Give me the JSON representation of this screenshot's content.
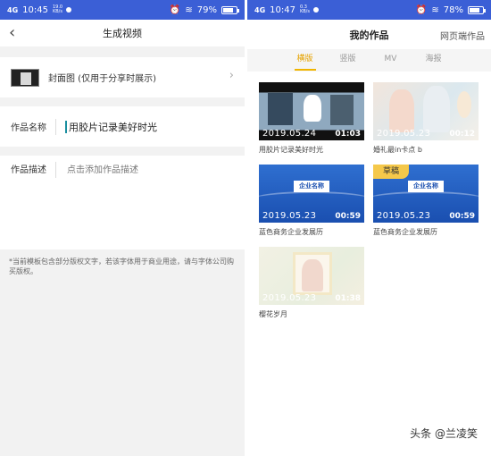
{
  "left": {
    "status": {
      "time": "10:45",
      "network": "4G",
      "speed": "19.0 KB/s",
      "battery": "79%",
      "battery_level": 0.79
    },
    "nav": {
      "back_icon": "chevron-left-icon",
      "title": "生成视频"
    },
    "cover": {
      "label": "封面图 (仅用于分享时展示)"
    },
    "name": {
      "label": "作品名称",
      "value": "用胶片记录美好时光"
    },
    "description": {
      "label": "作品描述",
      "placeholder": "点击添加作品描述"
    },
    "notice": "*当前模板包含部分版权文字，若该字体用于商业用途，请与字体公司购买版权。"
  },
  "right": {
    "status": {
      "time": "10:47",
      "network": "4G",
      "speed": "0.3 KB/s",
      "battery": "78%",
      "battery_level": 0.78
    },
    "nav": {
      "title": "我的作品",
      "web_link": "网页端作品"
    },
    "tabs": [
      "横版",
      "竖版",
      "MV",
      "海报"
    ],
    "active_tab": "横版",
    "works": [
      {
        "date": "2019.05.24",
        "duration": "01:03",
        "title": "用胶片记录美好时光",
        "draft": ""
      },
      {
        "date": "2019.05.23",
        "duration": "00:12",
        "title": "婚礼最in卡点 b",
        "draft": ""
      },
      {
        "date": "2019.05.23",
        "duration": "00:59",
        "title": "蓝色商务企业发展历",
        "draft": "",
        "plate": "企业名称"
      },
      {
        "date": "2019.05.23",
        "duration": "00:59",
        "title": "蓝色商务企业发展历",
        "draft": "草稿",
        "plate": "企业名称"
      },
      {
        "date": "2019.05.23",
        "duration": "01:38",
        "title": "樱花岁月",
        "draft": ""
      }
    ]
  },
  "watermark": "头条 @兰凌笑",
  "colors": {
    "statusbar": "#3b5fd6",
    "accent": "#f0b400",
    "draft_badge": "#f5c84a"
  }
}
